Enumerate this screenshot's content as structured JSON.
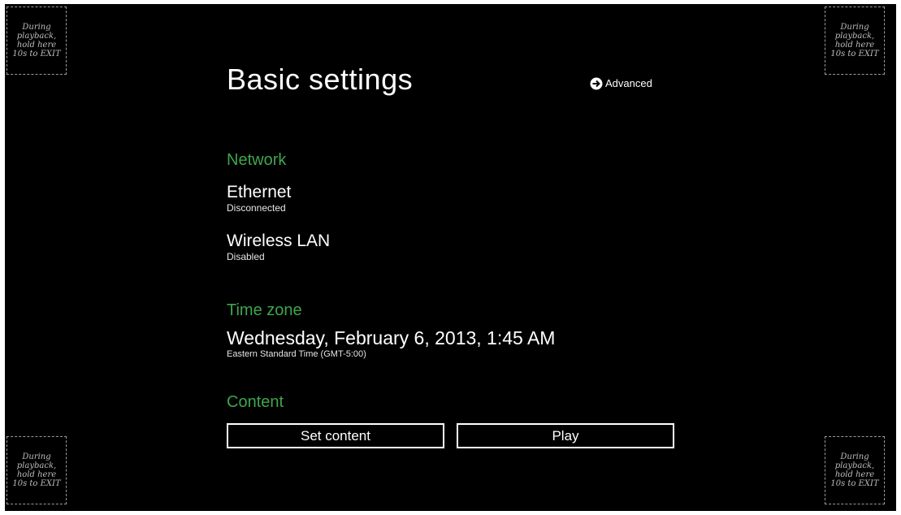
{
  "page": {
    "title": "Basic settings",
    "advanced_label": "Advanced"
  },
  "corner_hint": "During\nplayback,\nhold here\n10s to EXIT",
  "sections": {
    "network": {
      "label": "Network",
      "items": [
        {
          "title": "Ethernet",
          "status": "Disconnected"
        },
        {
          "title": "Wireless LAN",
          "status": "Disabled"
        }
      ]
    },
    "timezone": {
      "label": "Time zone",
      "datetime": "Wednesday, February 6, 2013, 1:45 AM",
      "zone": "Eastern Standard Time (GMT-5:00)"
    },
    "content": {
      "label": "Content",
      "set_content_label": "Set content",
      "play_label": "Play"
    }
  },
  "colors": {
    "background": "#000000",
    "section_header": "#3fa54d",
    "text": "#ffffff",
    "hint_border": "#9a9a9a"
  },
  "icons": {
    "advanced": "arrow-right-circle-icon"
  }
}
